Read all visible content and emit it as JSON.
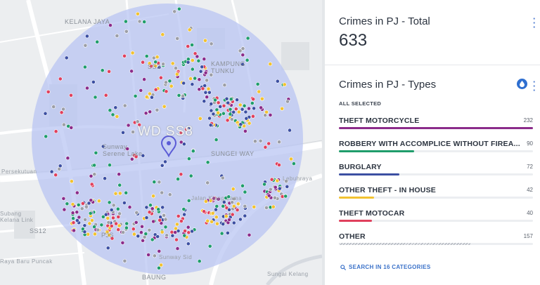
{
  "map": {
    "place_labels": [
      "KELANA JAYA",
      "SS3",
      "KAMPUNG TUNKU",
      "WD SS8",
      "Sunway Serene Lake",
      "SUNGEI WAY",
      "Persekutuan",
      "Lebuhraya",
      "Subang Kelana Link",
      "SS12",
      "PJS",
      "Raya Baru Puncak",
      "Jalan Klang Lama",
      "Sunway Sid",
      "BAUNG",
      "Sungai Kelang"
    ],
    "colors": {
      "circle": "#b7c4f2",
      "marker": "#5b5bd6"
    },
    "point_colors": {
      "theft_motorcycle": "#8b2c8a",
      "robbery": "#1f9d6b",
      "burglary": "#3c4fa2",
      "other_theft": "#f2c230",
      "theft_motocar": "#e0405c",
      "other": "#9c9ea6"
    }
  },
  "total_card": {
    "title": "Crimes in PJ - Total",
    "value": "633",
    "menu_icon": "kebab-icon"
  },
  "types_card": {
    "title": "Crimes in PJ - Types",
    "filter_icon": "drop-icon",
    "menu_icon": "kebab-icon",
    "selection_label": "ALL SELECTED",
    "categories": [
      {
        "label": "THEFT MOTORCYCLE",
        "count": "232",
        "fraction": 1.0,
        "color": "#8b2c8a",
        "hatched": false
      },
      {
        "label": "ROBBERY WITH ACCOMPLICE WITHOUT FIREA...",
        "count": "90",
        "fraction": 0.388,
        "color": "#1f9d6b",
        "hatched": false
      },
      {
        "label": "BURGLARY",
        "count": "72",
        "fraction": 0.31,
        "color": "#3c4fa2",
        "hatched": false
      },
      {
        "label": "OTHER THEFT - IN HOUSE",
        "count": "42",
        "fraction": 0.181,
        "color": "#f2c230",
        "hatched": false
      },
      {
        "label": "THEFT MOTOCAR",
        "count": "40",
        "fraction": 0.172,
        "color": "#e0405c",
        "hatched": false
      },
      {
        "label": "OTHER",
        "count": "157",
        "fraction": 0.677,
        "color": "#a9aeb6",
        "hatched": true
      }
    ],
    "search_link": "SEARCH IN 16 CATEGORIES"
  }
}
